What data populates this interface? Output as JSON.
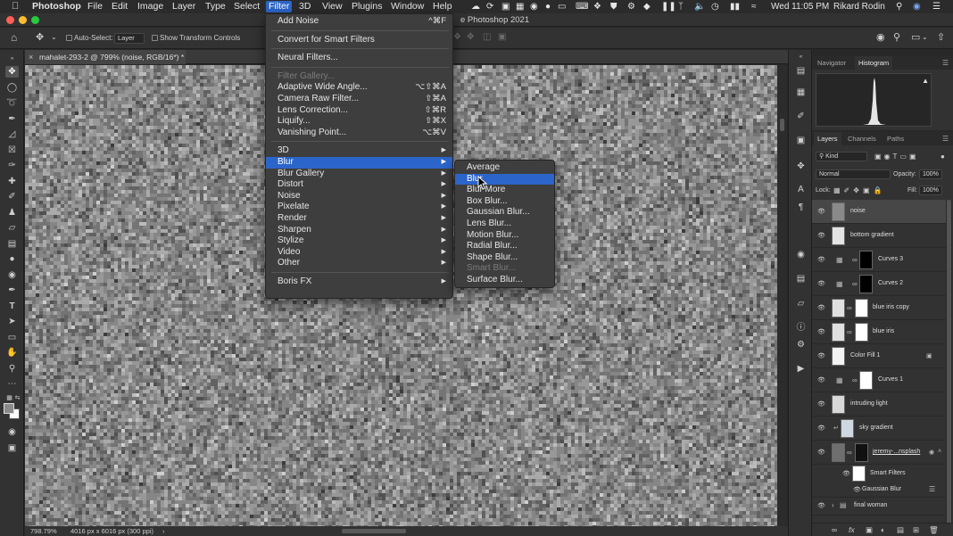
{
  "menubar": {
    "apple_icon": "apple-logo-icon",
    "app_name": "Photoshop",
    "items": [
      "File",
      "Edit",
      "Image",
      "Layer",
      "Type",
      "Select",
      "Filter",
      "3D",
      "View",
      "Plugins",
      "Window",
      "Help"
    ],
    "active_item": "Filter",
    "datetime": "Wed 11:05 PM",
    "user": "Rikard Rodin"
  },
  "window": {
    "title_fragment": "e Photoshop 2021"
  },
  "options_bar": {
    "auto_select_label": "Auto-Select:",
    "auto_select_value": "Layer",
    "transform_controls_label": "Show Transform Controls"
  },
  "document": {
    "tab_label": "mahalet-293-2 @ 799% (noise, RGB/16*) *",
    "zoom": "798.79%",
    "dimensions": "4016 px x 6016 px (300 ppi)"
  },
  "panels": {
    "top_tabs": [
      "Navigator",
      "Histogram"
    ],
    "top_active": "Histogram",
    "layer_tabs": [
      "Layers",
      "Channels",
      "Paths"
    ],
    "layer_active": "Layers",
    "kind_filter": "Kind",
    "blend_mode": "Normal",
    "opacity_label": "Opacity:",
    "opacity_value": "100%",
    "lock_label": "Lock:",
    "fill_label": "Fill:",
    "fill_value": "100%"
  },
  "layers": [
    {
      "name": "noise",
      "selected": true
    },
    {
      "name": "bottom gradient"
    },
    {
      "name": "Curves 3"
    },
    {
      "name": "Curves 2"
    },
    {
      "name": "blue iris copy"
    },
    {
      "name": "blue iris"
    },
    {
      "name": "Color Fill 1"
    },
    {
      "name": "Curves 1"
    },
    {
      "name": "intruding light"
    },
    {
      "name": "sky gradient"
    },
    {
      "name": "jeremy-...nsplash"
    },
    {
      "name": "Smart Filters"
    },
    {
      "name": "Gaussian Blur"
    },
    {
      "name": "final woman"
    }
  ],
  "filter_menu": [
    {
      "label": "Add Noise",
      "shortcut": "^⌘F"
    },
    {
      "sep": true
    },
    {
      "label": "Convert for Smart Filters"
    },
    {
      "sep": true
    },
    {
      "label": "Neural Filters..."
    },
    {
      "sep": true
    },
    {
      "label": "Filter Gallery...",
      "disabled": true
    },
    {
      "label": "Adaptive Wide Angle...",
      "shortcut": "⌥⇧⌘A"
    },
    {
      "label": "Camera Raw Filter...",
      "shortcut": "⇧⌘A"
    },
    {
      "label": "Lens Correction...",
      "shortcut": "⇧⌘R"
    },
    {
      "label": "Liquify...",
      "shortcut": "⇧⌘X"
    },
    {
      "label": "Vanishing Point...",
      "shortcut": "⌥⌘V"
    },
    {
      "sep": true
    },
    {
      "label": "3D",
      "sub": true
    },
    {
      "label": "Blur",
      "sub": true,
      "highlighted": true
    },
    {
      "label": "Blur Gallery",
      "sub": true
    },
    {
      "label": "Distort",
      "sub": true
    },
    {
      "label": "Noise",
      "sub": true
    },
    {
      "label": "Pixelate",
      "sub": true
    },
    {
      "label": "Render",
      "sub": true
    },
    {
      "label": "Sharpen",
      "sub": true
    },
    {
      "label": "Stylize",
      "sub": true
    },
    {
      "label": "Video",
      "sub": true
    },
    {
      "label": "Other",
      "sub": true
    },
    {
      "sep": true
    },
    {
      "label": "Boris FX",
      "sub": true
    }
  ],
  "blur_submenu": [
    {
      "label": "Average"
    },
    {
      "label": "Blur",
      "highlighted": true
    },
    {
      "label": "Blur More"
    },
    {
      "label": "Box Blur..."
    },
    {
      "label": "Gaussian Blur..."
    },
    {
      "label": "Lens Blur..."
    },
    {
      "label": "Motion Blur..."
    },
    {
      "label": "Radial Blur..."
    },
    {
      "label": "Shape Blur..."
    },
    {
      "label": "Smart Blur...",
      "disabled": true
    },
    {
      "label": "Surface Blur..."
    }
  ],
  "colors": {
    "highlight": "#2c65c9",
    "menu_bg": "#3e3e3e",
    "panel_bg": "#323232"
  }
}
